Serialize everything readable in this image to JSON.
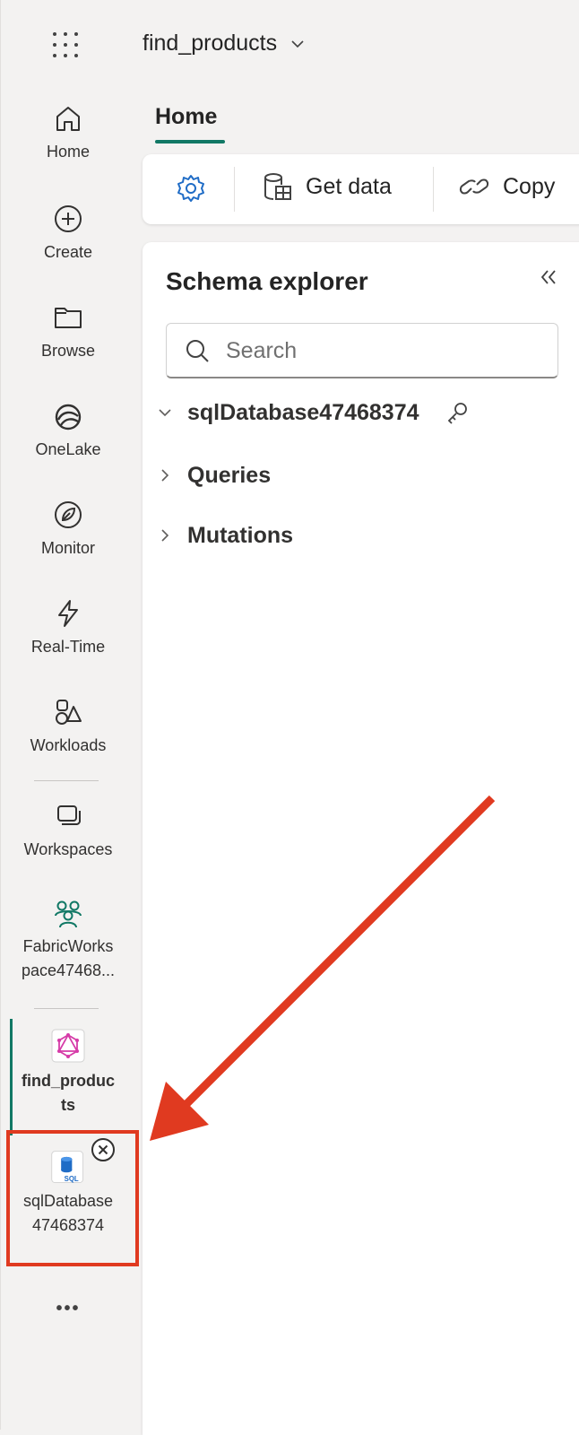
{
  "topbar": {
    "item_title": "find_products"
  },
  "rail": {
    "home": "Home",
    "create": "Create",
    "browse": "Browse",
    "onelake": "OneLake",
    "monitor": "Monitor",
    "realtime": "Real-Time",
    "workloads": "Workloads",
    "workspaces": "Workspaces",
    "workspace_line1": "FabricWorks",
    "workspace_line2": "pace47468...",
    "find_products_line1": "find_produc",
    "find_products_line2": "ts",
    "sqldb_line1": "sqlDatabase",
    "sqldb_line2": "47468374",
    "sql_badge": "SQL",
    "more": "•••"
  },
  "tabs": {
    "home": "Home"
  },
  "ribbon": {
    "get_data": "Get data",
    "copy": "Copy"
  },
  "schema": {
    "title": "Schema explorer",
    "search_placeholder": "Search",
    "database": "sqlDatabase47468374",
    "queries": "Queries",
    "mutations": "Mutations"
  },
  "colors": {
    "accent": "#117865",
    "annotation": "#e03a20",
    "rail_bg": "#f3f2f1"
  }
}
